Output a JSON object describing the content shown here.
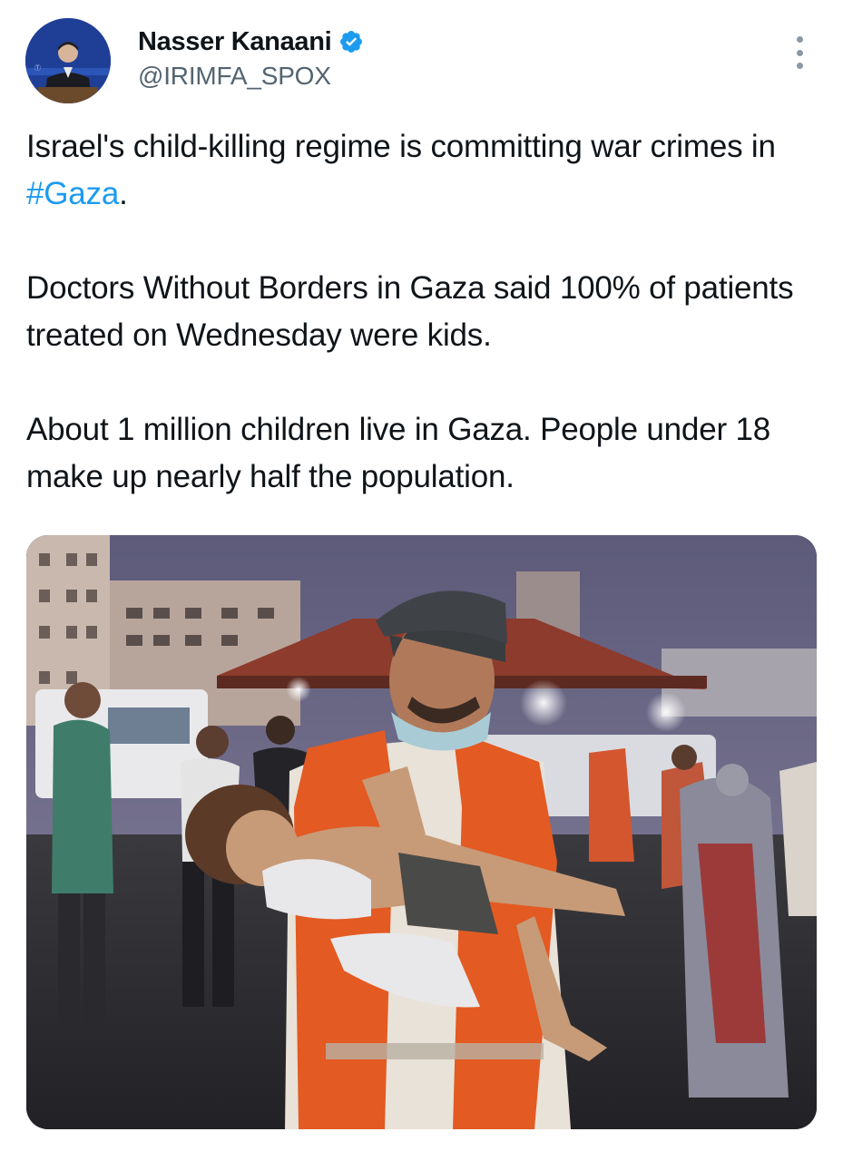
{
  "author": {
    "display_name": "Nasser Kanaani",
    "handle": "@IRIMFA_SPOX",
    "verified": true,
    "verified_color": "#1d9bf0"
  },
  "tweet": {
    "line1_before": "Israel's child-killing regime is committing war crimes in ",
    "hashtag": "#Gaza",
    "line1_after": ".",
    "paragraph2": "Doctors Without Borders in Gaza said 100% of patients treated on Wednesday were kids.",
    "paragraph3": "About 1 million children live in Gaza. People under 18 make up nearly half the population."
  },
  "icons": {
    "verified": "verified-badge-icon",
    "more": "more-options-icon"
  },
  "colors": {
    "text": "#0f1419",
    "secondary": "#536471",
    "link": "#1d9bf0"
  }
}
